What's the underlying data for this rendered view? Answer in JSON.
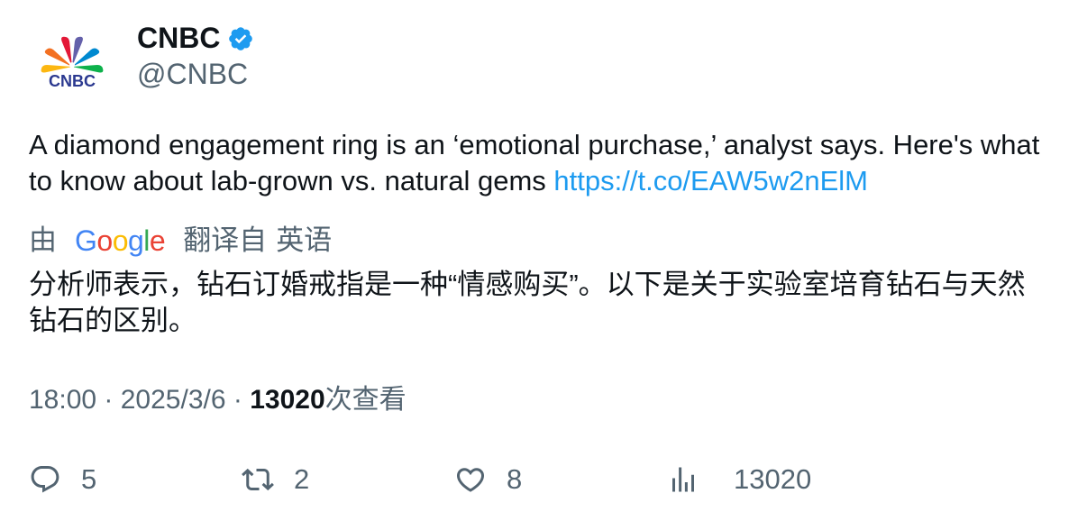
{
  "author": {
    "name": "CNBC",
    "handle": "@CNBC",
    "logo_text": "CNBC"
  },
  "tweet": {
    "text": "A diamond engagement ring is an ‘emotional purchase,’ analyst says. Here's what to know about lab-grown vs. natural gems ",
    "link": "https://t.co/EAW5w2nElM"
  },
  "translation": {
    "by_label": "由",
    "provider": "Google",
    "translated_from": "翻译自",
    "source_language": "英语",
    "text": "分析师表示，钻石订婚戒指是一种“情感购买”。以下是关于实验室培育钻石与天然钻石的区别。"
  },
  "meta": {
    "time": "18:00",
    "separator": " · ",
    "date": "2025/3/6",
    "views_count": "13020",
    "views_label": "次查看"
  },
  "actions": {
    "replies": "5",
    "retweets": "2",
    "likes": "8",
    "views": "13020"
  },
  "colors": {
    "link": "#1d9bf0",
    "verified": "#1d9bf0",
    "secondary_text": "#536471",
    "primary_text": "#0f1419"
  }
}
